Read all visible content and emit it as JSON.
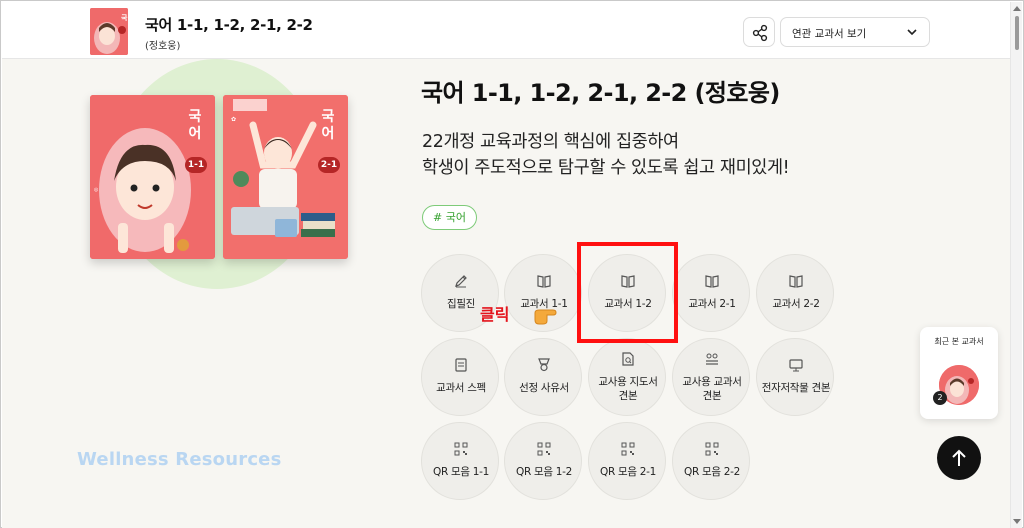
{
  "header": {
    "title": "국어 1-1, 1-2, 2-1, 2-2",
    "subtitle": "(정호웅)",
    "share_icon": "share-icon",
    "related_select": "연관 교과서 보기"
  },
  "books": [
    {
      "title_vertical": "국어",
      "badge": "1-1"
    },
    {
      "title_vertical": "국어",
      "badge": "2-1"
    }
  ],
  "watermark": "Wellness Resources",
  "page": {
    "title": "국어 1-1, 1-2, 2-1, 2-2 (정호웅)",
    "desc_line1": "22개정 교육과정의 핵심에 집중하여",
    "desc_line2": "학생이 주도적으로 탐구할 수 있도록 쉽고 재미있게!",
    "tag": "# 국어"
  },
  "buttons": [
    {
      "label": "집필진",
      "icon": "pencil-icon"
    },
    {
      "label": "교과서 1-1",
      "icon": "book-icon"
    },
    {
      "label": "교과서 1-2",
      "icon": "book-icon"
    },
    {
      "label": "교과서 2-1",
      "icon": "book-icon"
    },
    {
      "label": "교과서 2-2",
      "icon": "book-icon"
    },
    {
      "label": "교과서 스펙",
      "icon": "document-icon"
    },
    {
      "label": "선정 사유서",
      "icon": "award-icon"
    },
    {
      "label_line1": "교사용 지도서",
      "label_line2": "견본",
      "icon": "file-search-icon"
    },
    {
      "label_line1": "교사용 교과서",
      "label_line2": "견본",
      "icon": "teacher-icon"
    },
    {
      "label": "전자저작물 견본",
      "icon": "monitor-icon"
    },
    {
      "label": "QR 모음 1-1",
      "icon": "qr-icon"
    },
    {
      "label": "QR 모음 1-2",
      "icon": "qr-icon"
    },
    {
      "label": "QR 모음 2-1",
      "icon": "qr-icon"
    },
    {
      "label": "QR 모음 2-2",
      "icon": "qr-icon"
    }
  ],
  "annotation": {
    "click_text": "클릭",
    "hand_icon": "pointing-hand-icon"
  },
  "recent": {
    "title": "최근 본 교과서",
    "count": "2"
  },
  "colors": {
    "accent_red": "#ff1010",
    "tag_green": "#35a12f",
    "book_red": "#f06a6a"
  }
}
